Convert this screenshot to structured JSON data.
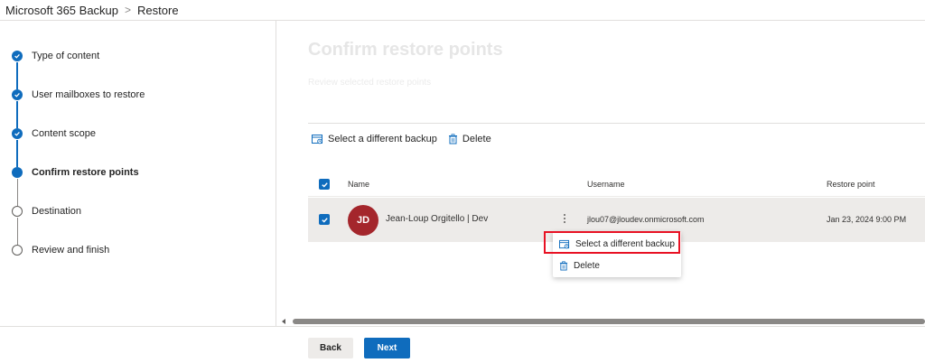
{
  "breadcrumb": {
    "root": "Microsoft 365 Backup",
    "separator": ">",
    "current": "Restore"
  },
  "steps": [
    {
      "label": "Type of content",
      "state": "done"
    },
    {
      "label": "User mailboxes to restore",
      "state": "done"
    },
    {
      "label": "Content scope",
      "state": "done"
    },
    {
      "label": "Confirm restore points",
      "state": "current"
    },
    {
      "label": "Destination",
      "state": "todo"
    },
    {
      "label": "Review and finish",
      "state": "todo"
    }
  ],
  "main": {
    "title": "Confirm restore points",
    "subtitle": "Review selected restore points",
    "commands": {
      "select_backup": "Select a different backup",
      "delete": "Delete"
    },
    "table": {
      "columns": {
        "name": "Name",
        "username": "Username",
        "restore_point": "Restore point"
      },
      "rows": [
        {
          "initials": "JD",
          "name": "Jean-Loup Orgitello | Dev",
          "username": "jlou07@jloudev.onmicrosoft.com",
          "restore_point": "Jan 23, 2024 9:00 PM"
        }
      ]
    },
    "context_menu": {
      "select_backup": "Select a different backup",
      "delete": "Delete"
    }
  },
  "footer": {
    "back": "Back",
    "next": "Next"
  },
  "colors": {
    "accent": "#0f6cbd",
    "avatar": "#a4262c",
    "highlight": "#e81123"
  }
}
